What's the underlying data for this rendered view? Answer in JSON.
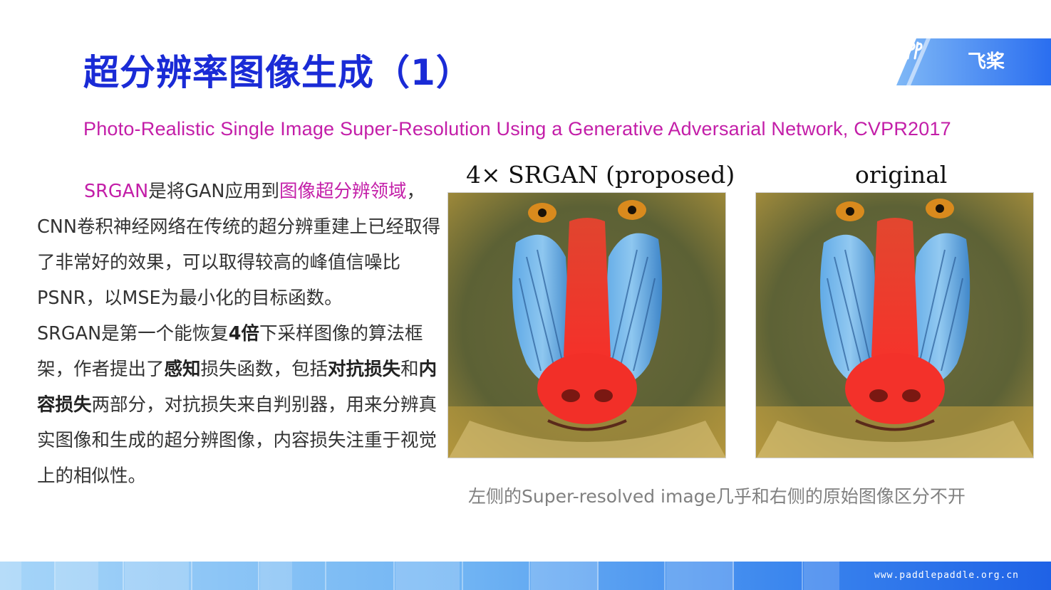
{
  "slide": {
    "title": "超分辨率图像生成（1）",
    "subtitle": "Photo-Realistic Single Image Super-Resolution Using a Generative Adversarial Network, CVPR2017"
  },
  "logo": {
    "name": "飞桨",
    "icon": "paddle-logo-icon"
  },
  "body": {
    "p1_hl1": "SRGAN",
    "p1_t1": "是将GAN应用到",
    "p1_hl2": "图像超分辨领域",
    "p1_t2": "，CNN卷积神经网络在传统的超分辨重建上已经取得了非常好的效果，可以取得较高的峰值信噪比PSNR，以MSE为最小化的目标函数。",
    "p2_t1": "SRGAN是第一个能恢复",
    "p2_b1": "4倍",
    "p2_t2": "下采样图像的算法框架，作者提出了",
    "p2_b2": "感知",
    "p2_t3": "损失函数，包括",
    "p2_b3": "对抗损失",
    "p2_t4": "和",
    "p2_b4": "内容损失",
    "p2_t5": "两部分，对抗损失来自判别器，用来分辨真实图像和生成的超分辨图像，内容损失注重于视觉上的相似性。"
  },
  "figure": {
    "left_label": "4× SRGAN (proposed)",
    "right_label": "original",
    "caption": "左侧的Super-resolved image几乎和右侧的原始图像区分不开"
  },
  "footer": {
    "url": "www.paddlepaddle.org.cn"
  },
  "colors": {
    "title": "#1a2bd6",
    "accent": "#c31ea8",
    "bar_light": "#9fd0f7",
    "bar_dark": "#1f6de6"
  }
}
